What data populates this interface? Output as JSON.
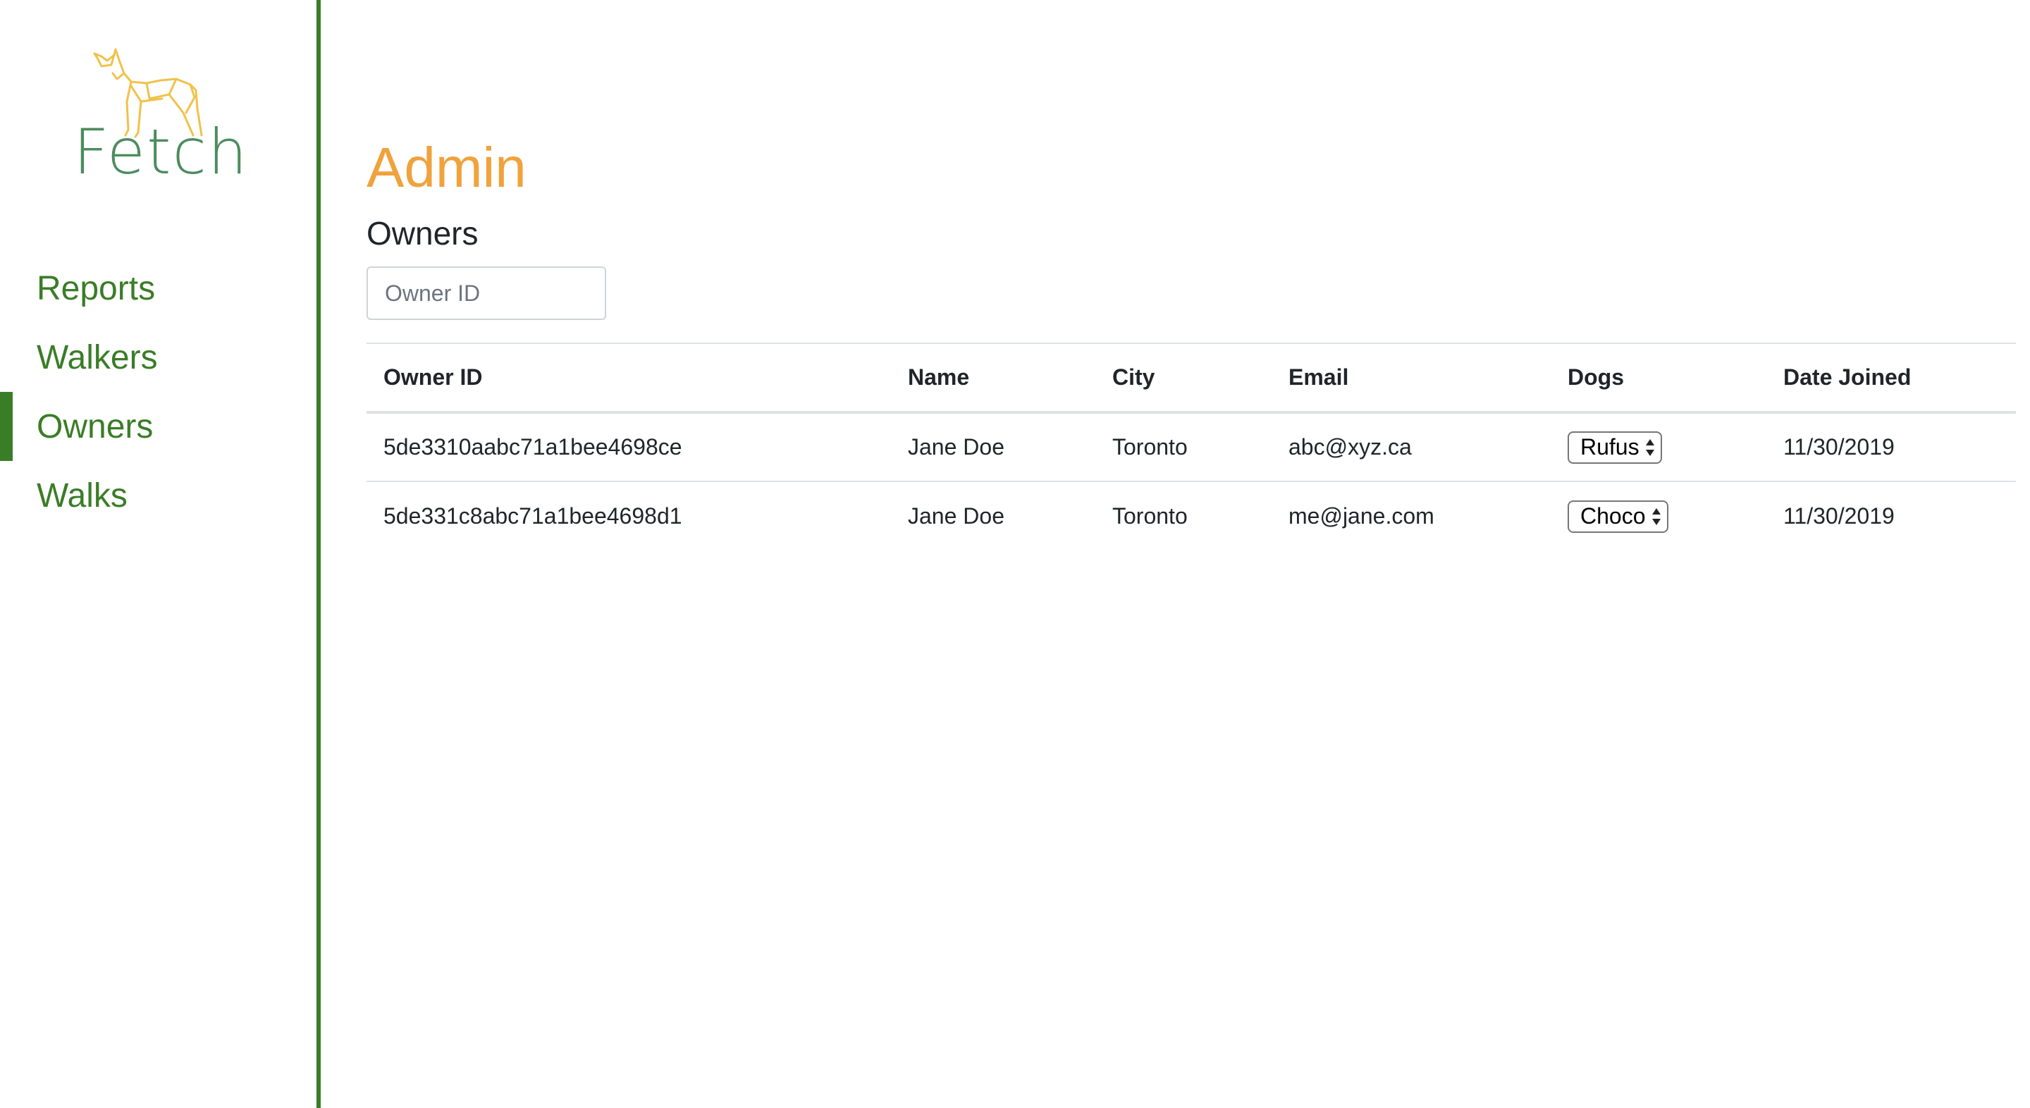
{
  "brand": {
    "name": "Fetch",
    "logo_icon": "dog-outline-icon",
    "logo_color": "#f0c24a",
    "text_color": "#4c8c5f"
  },
  "sidebar": {
    "accent": "#3a7d27",
    "items": [
      {
        "label": "Reports",
        "active": false
      },
      {
        "label": "Walkers",
        "active": false
      },
      {
        "label": "Owners",
        "active": true
      },
      {
        "label": "Walks",
        "active": false
      }
    ]
  },
  "main": {
    "title": "Admin",
    "title_color": "#f0a23c",
    "section_title": "Owners",
    "search": {
      "placeholder": "Owner ID",
      "value": ""
    },
    "table": {
      "columns": [
        "Owner ID",
        "Name",
        "City",
        "Email",
        "Dogs",
        "Date Joined"
      ],
      "rows": [
        {
          "owner_id": "5de3310aabc71a1bee4698ce",
          "name": "Jane Doe",
          "city": "Toronto",
          "email": "abc@xyz.ca",
          "dog_selected": "Rufus",
          "date_joined": "11/30/2019"
        },
        {
          "owner_id": "5de331c8abc71a1bee4698d1",
          "name": "Jane Doe",
          "city": "Toronto",
          "email": "me@jane.com",
          "dog_selected": "Choco",
          "date_joined": "11/30/2019"
        }
      ]
    }
  }
}
